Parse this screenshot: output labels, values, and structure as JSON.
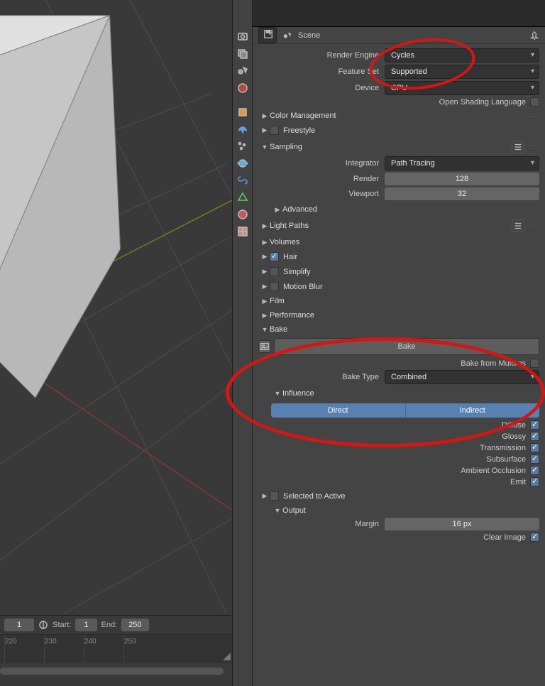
{
  "breadcrumb": {
    "scene_label": "Scene"
  },
  "render_engine": {
    "label": "Render Engine",
    "value": "Cycles"
  },
  "feature_set": {
    "label": "Feature Set",
    "value": "Supported"
  },
  "device": {
    "label": "Device",
    "value": "CPU"
  },
  "osl": {
    "label": "Open Shading Language"
  },
  "panels": {
    "color_mgmt": "Color Management",
    "freestyle": "Freestyle",
    "sampling": "Sampling",
    "advanced": "Advanced",
    "light_paths": "Light Paths",
    "volumes": "Volumes",
    "hair": "Hair",
    "simplify": "Simplify",
    "motion_blur": "Motion Blur",
    "film": "Film",
    "performance": "Performance",
    "bake": "Bake",
    "influence": "Influence",
    "sel2active": "Selected to Active",
    "output": "Output"
  },
  "sampling": {
    "integrator_label": "Integrator",
    "integrator_value": "Path Tracing",
    "render_label": "Render",
    "render_value": "128",
    "viewport_label": "Viewport",
    "viewport_value": "32"
  },
  "bake": {
    "button": "Bake",
    "from_multires": "Bake from Multires",
    "type_label": "Bake Type",
    "type_value": "Combined"
  },
  "influence": {
    "direct": "Direct",
    "indirect": "Indirect",
    "diffuse": "Diffuse",
    "glossy": "Glossy",
    "transmission": "Transmission",
    "subsurface": "Subsurface",
    "ao": "Ambient Occlusion",
    "emit": "Emit"
  },
  "output": {
    "margin_label": "Margin",
    "margin_value": "16 px",
    "clear_image": "Clear Image"
  },
  "timeline": {
    "current": "1",
    "start_label": "Start:",
    "start_value": "1",
    "end_label": "End:",
    "end_value": "250",
    "ticks": [
      "220",
      "230",
      "240",
      "250"
    ]
  }
}
